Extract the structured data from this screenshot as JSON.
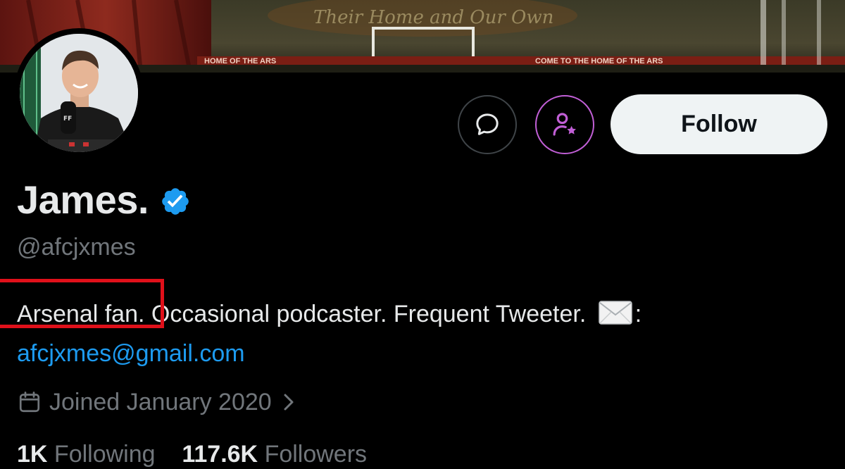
{
  "banner": {
    "banner_text_left": "HOME OF THE ARS",
    "banner_text_right": "COME TO THE HOME OF THE ARS",
    "banner_tifo_text": "Their Home and Our Own"
  },
  "profile": {
    "display_name": "James.",
    "handle": "@afcjxmes",
    "bio_highlight": "Arsenal fan",
    "bio_rest": ". Occasional podcaster. Frequent Tweeter. ",
    "bio_colon": ":",
    "bio_email": "afcjxmes@gmail.com",
    "joined": "Joined January 2020"
  },
  "actions": {
    "follow_label": "Follow"
  },
  "stats": {
    "following_count": "1K",
    "following_label": "Following",
    "followers_count": "117.6K",
    "followers_label": "Followers"
  },
  "icons": {
    "message": "message-icon",
    "subscribe": "subscribe-person-star-icon",
    "verified": "verified-badge-icon",
    "calendar": "calendar-icon",
    "chevron": "chevron-right-icon",
    "envelope": "envelope-emoji"
  },
  "colors": {
    "background": "#000000",
    "text_primary": "#e7e9ea",
    "text_secondary": "#71767b",
    "link": "#1d9bf0",
    "verified": "#1d9bf0",
    "subscribe_accent": "#c15fd6",
    "highlight_box": "#e0101a",
    "follow_bg": "#eff3f4"
  }
}
